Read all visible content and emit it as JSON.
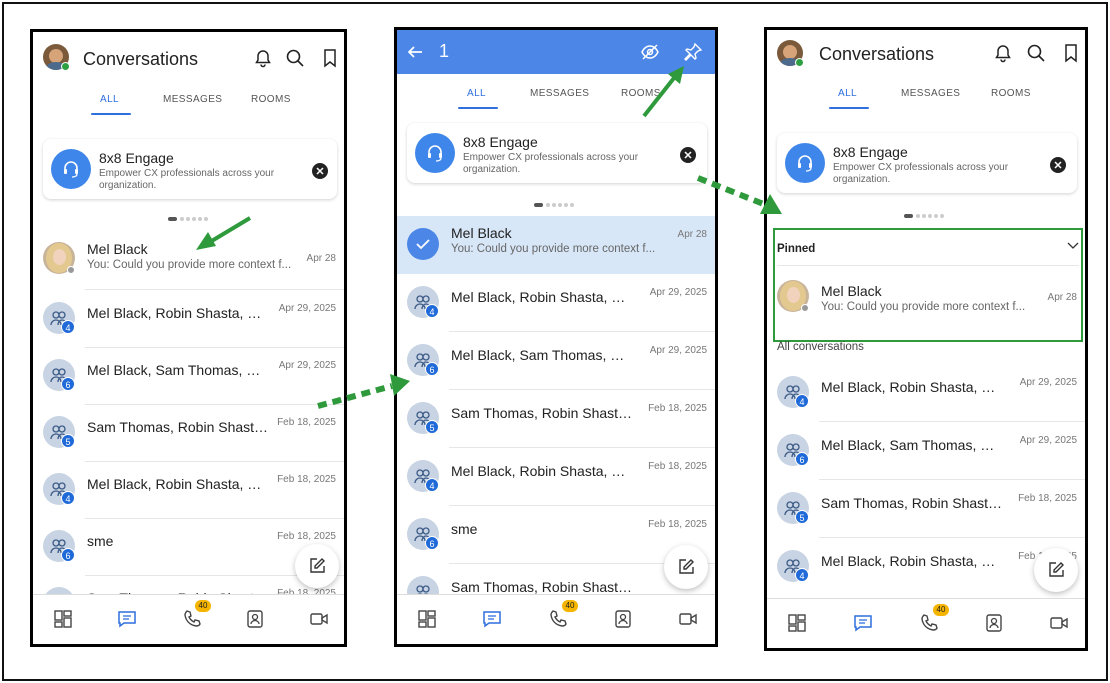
{
  "header": {
    "title": "Conversations"
  },
  "tabs": [
    "ALL",
    "MESSAGES",
    "ROOMS"
  ],
  "promo": {
    "title": "8x8 Engage",
    "desc": "Empower CX professionals across your organization."
  },
  "selection": {
    "count": "1"
  },
  "conversations": [
    {
      "name": "Mel Black",
      "preview": "You: Could you provide more context f...",
      "date": "Apr 28",
      "type": "person"
    },
    {
      "name": "Mel Black, Robin Shasta, Sa...",
      "preview": "",
      "date": "Apr 29, 2025",
      "badge": "4",
      "type": "group"
    },
    {
      "name": "Mel Black, Sam Thomas, Sar...",
      "preview": "",
      "date": "Apr 29, 2025",
      "badge": "6",
      "type": "group"
    },
    {
      "name": "Sam Thomas, Robin Shasta, ...",
      "preview": "",
      "date": "Feb 18, 2025",
      "badge": "5",
      "type": "group"
    },
    {
      "name": "Mel Black, Robin Shasta, +14...",
      "preview": "",
      "date": "Feb 18, 2025",
      "badge": "4",
      "type": "group"
    },
    {
      "name": "sme",
      "preview": "",
      "date": "Feb 18, 2025",
      "badge": "6",
      "type": "group"
    },
    {
      "name": "Sam Thomas, Robin Shasta, ...",
      "preview": "",
      "date": "Feb 18, 2025",
      "badge": "",
      "type": "group"
    }
  ],
  "pinned": {
    "label": "Pinned",
    "all_label": "All conversations"
  },
  "nav": {
    "calls_badge": "40"
  },
  "icons": [
    "bell-icon",
    "search-icon",
    "bookmark-icon",
    "back-arrow-icon",
    "hide-icon",
    "pin-icon",
    "headset-icon",
    "close-icon",
    "compose-icon",
    "dashboard-icon",
    "chat-icon",
    "phone-icon",
    "contacts-icon",
    "video-icon",
    "chevron-down-icon"
  ],
  "colors": {
    "accent": "#2f6fde",
    "selection_bar": "#4c87e8",
    "selected_row": "#d8e7f8",
    "badge": "#1f6ad8",
    "calls_badge": "#f4b400",
    "annotation": "#2e9a3c"
  }
}
